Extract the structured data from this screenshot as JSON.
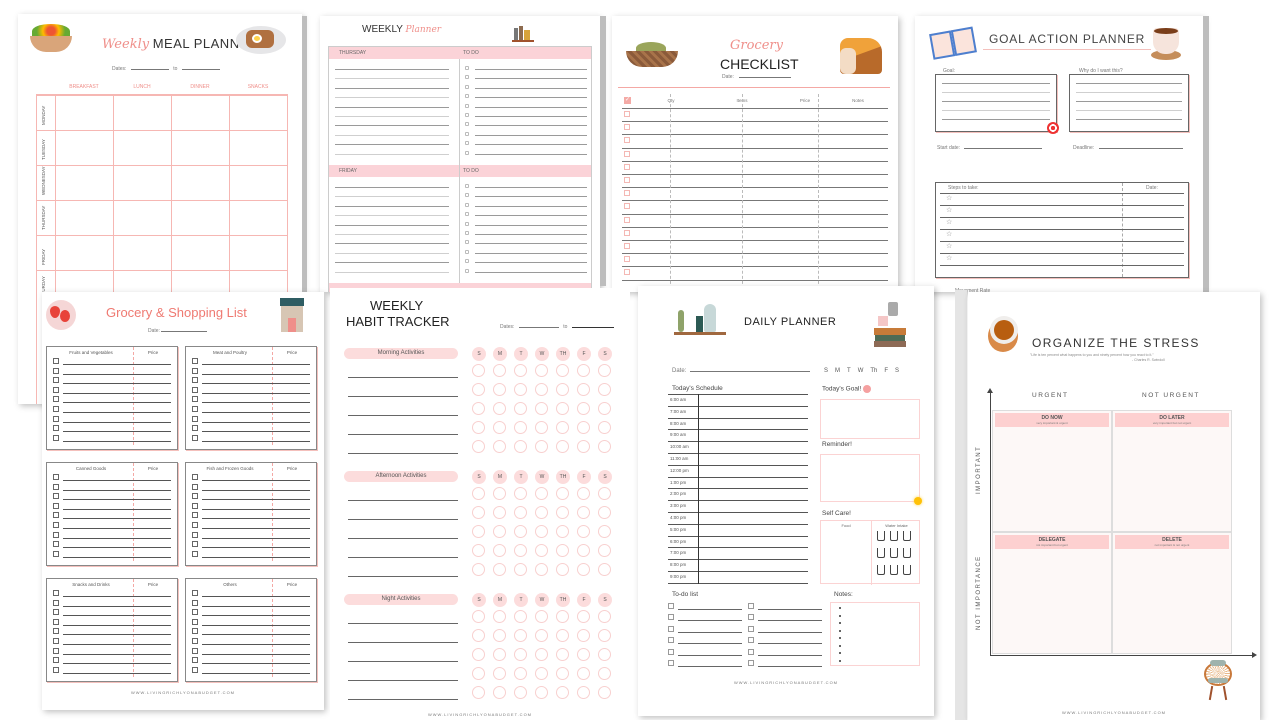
{
  "accent_color": "#ef8f8a",
  "meal_planner": {
    "title_script": "Weekly",
    "title": "MEAL PLANNER",
    "dates_label": "Dates:",
    "to_label": "to",
    "columns": [
      "BREAKFAST",
      "LUNCH",
      "DINNER",
      "SNACKS"
    ],
    "days": [
      "MONDAY",
      "TUESDAY",
      "WEDNESDAY",
      "THURSDAY",
      "FRIDAY",
      "SATURDAY"
    ],
    "icons": [
      "salad-bowl-icon",
      "toast-plate-icon"
    ]
  },
  "weekly_planner": {
    "title": "WEEKLY",
    "title_script": "Planner",
    "sections": [
      {
        "day": "THURSDAY",
        "todo": "TO DO"
      },
      {
        "day": "FRIDAY",
        "todo": "TO DO"
      }
    ]
  },
  "grocery_checklist": {
    "title_script": "Grocery",
    "title": "CHECKLIST",
    "date_label": "Date:",
    "columns": [
      "Qty",
      "Items",
      "Price",
      "Notes"
    ]
  },
  "goal_planner": {
    "title": "GOAL ACTION PLANNER",
    "goal_label": "Goal:",
    "why_label": "Why do I want this?",
    "start_label": "Start date:",
    "deadline_label": "Deadline:",
    "steps_label": "Steps to take:",
    "date_label": "Date:",
    "star_count": 6,
    "peek_text": "Movement Rate"
  },
  "shopping_list": {
    "title": "Grocery & Shopping List",
    "date_label": "Date:",
    "price_label": "Price",
    "categories": [
      "Fruits and Vegetables",
      "Meat and Poultry",
      "Canned Goods",
      "Fish and Frozen Goods",
      "Snacks and Drinks",
      "Others"
    ],
    "footer": "WWW.LIVINGRICHLYONABUDGET.COM"
  },
  "habit_tracker": {
    "title_line1": "WEEKLY",
    "title_line2": "HABIT TRACKER",
    "dates_label": "Dates:",
    "to_label": "to",
    "sections": [
      "Morning Activities",
      "Afternoon Activities",
      "Night Activities"
    ],
    "weekdays": [
      "S",
      "M",
      "T",
      "W",
      "TH",
      "F",
      "S"
    ],
    "footer": "WWW.LIVINGRICHLYONABUDGET.COM"
  },
  "daily_planner": {
    "title": "DAILY PLANNER",
    "date_label": "Date:",
    "weekdays": [
      "S",
      "M",
      "T",
      "W",
      "Th",
      "F",
      "S"
    ],
    "schedule_label": "Today's Schedule",
    "times": [
      "6:00 am",
      "7:00 am",
      "8:00 am",
      "9:00 am",
      "10:00 am",
      "11:00 am",
      "12:00 pm",
      "1:00 pm",
      "2:00 pm",
      "3:00 pm",
      "4:00 pm",
      "5:00 pm",
      "6:00 pm",
      "7:00 pm",
      "8:00 pm",
      "9:00 pm"
    ],
    "goal_label": "Today's Goal!",
    "reminder_label": "Reminder!",
    "selfcare_label": "Self Care!",
    "food_label": "Food",
    "water_label": "Water Intake",
    "todo_label": "To-do list",
    "notes_label": "Notes:",
    "footer": "WWW.LIVINGRICHLYONABUDGET.COM"
  },
  "stress": {
    "title": "ORGANIZE THE STRESS",
    "quote": "\"Life is ten percent what happens to you and ninety percent how you react to it.\"",
    "author": "- Charles R. Swindoll",
    "urgent": "URGENT",
    "not_urgent": "NOT URGENT",
    "important": "IMPORTANT",
    "not_important": "NOT IMPORTANCE",
    "quadrants": [
      {
        "title": "DO NOW",
        "sub": "very important & urgent"
      },
      {
        "title": "DO LATER",
        "sub": "very important but not urgent"
      },
      {
        "title": "DELEGATE",
        "sub": "not important but urgent"
      },
      {
        "title": "DELETE",
        "sub": "not important & not urgent"
      }
    ],
    "footer": "WWW.LIVINGRICHLYONABUDGET.COM"
  }
}
